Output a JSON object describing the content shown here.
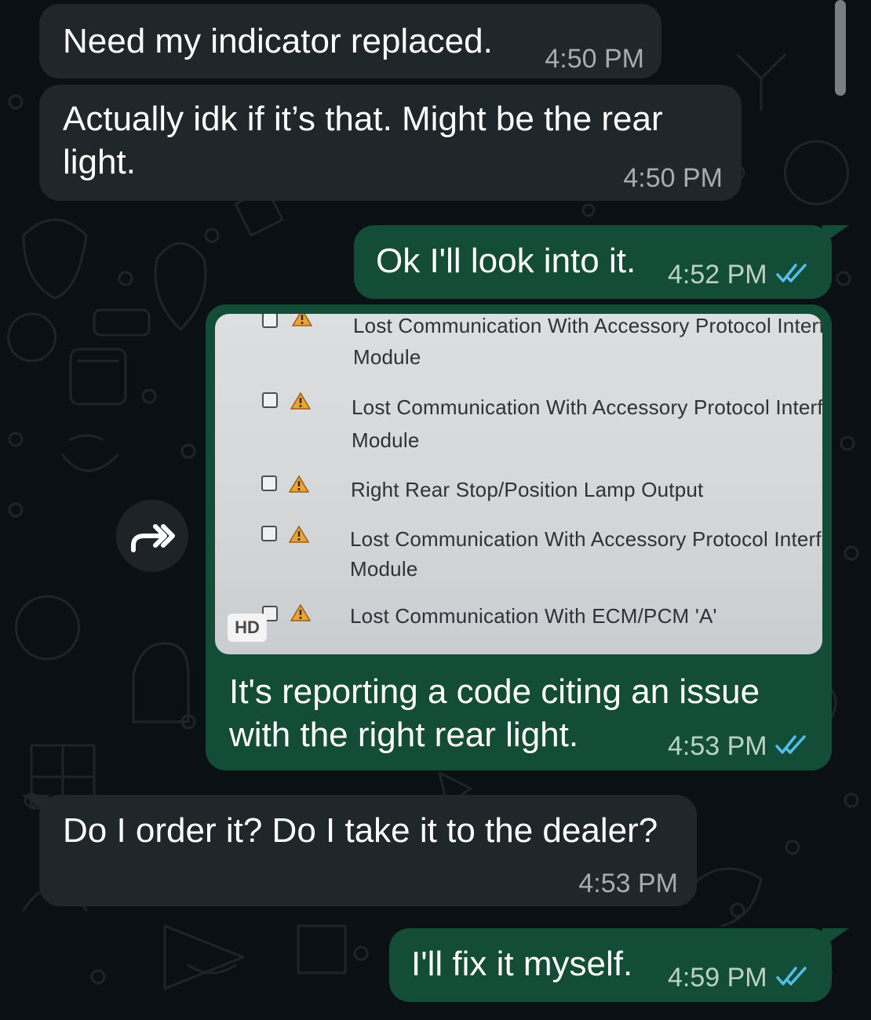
{
  "messages": [
    {
      "direction": "incoming",
      "text": "Need my indicator replaced.",
      "time": "4:50 PM"
    },
    {
      "direction": "incoming",
      "text": "Actually idk if it’s that. Might be the rear\nlight.",
      "time": "4:50 PM"
    },
    {
      "direction": "outgoing",
      "text": "Ok I'll look into it.",
      "time": "4:52 PM",
      "status": "read"
    },
    {
      "direction": "outgoing",
      "type": "image",
      "image": {
        "rows": [
          {
            "line1": "Lost Communication With Accessory Protocol Interfa",
            "line2": "Module"
          },
          {
            "line1": "Lost Communication With Accessory Protocol Interfa",
            "line2": "Module"
          },
          {
            "line1": "Right Rear Stop/Position Lamp Output",
            "line2": ""
          },
          {
            "line1": "Lost Communication With Accessory Protocol Interfac",
            "line2": "Module"
          },
          {
            "line1": "Lost Communication With ECM/PCM 'A'",
            "line2": ""
          }
        ],
        "badge": "HD"
      },
      "caption": "It's reporting a code citing an issue\nwith the right rear light.",
      "time": "4:53 PM",
      "status": "read"
    },
    {
      "direction": "incoming",
      "text": "Do I order it? Do I take it to the dealer?",
      "time": "4:53 PM"
    },
    {
      "direction": "outgoing",
      "text": "I'll fix it myself.",
      "time": "4:59 PM",
      "status": "read"
    }
  ],
  "icons": {
    "forward": "forward-icon",
    "read_ticks": "double-check-icon",
    "warning": "warning-triangle-icon",
    "checkbox": "checkbox-icon"
  },
  "colors": {
    "background": "#0b1014",
    "incoming_bubble": "#1f272a",
    "outgoing_bubble": "#144d37",
    "read_ticks": "#53bdeb",
    "text": "#ffffff"
  }
}
